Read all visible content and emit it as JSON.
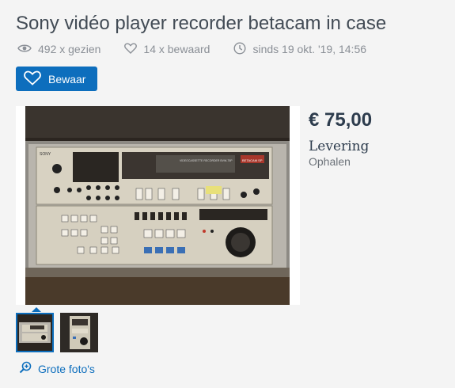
{
  "listing": {
    "title": "Sony vidéo player recorder betacam in case",
    "views": "492 x gezien",
    "saves": "14 x bewaard",
    "since": "sinds 19 okt. '19, 14:56",
    "save_button": "Bewaar",
    "price": "€ 75,00",
    "delivery_label": "Levering",
    "delivery_value": "Ophalen",
    "large_photos_link": "Grote foto's",
    "device_labels": {
      "brand": "SONY",
      "model": "VIDEOCASSETTE RECORDER BVW-75P",
      "logo": "BETACAM SP"
    }
  },
  "colors": {
    "accent": "#0d6ebd",
    "title": "#424b55",
    "muted": "#8a8f96",
    "background": "#f4f4f4"
  },
  "icons": {
    "views": "eye-icon",
    "saves": "heart-icon",
    "since": "clock-icon",
    "save_button": "heart-icon",
    "large_photos": "zoom-in-icon"
  }
}
